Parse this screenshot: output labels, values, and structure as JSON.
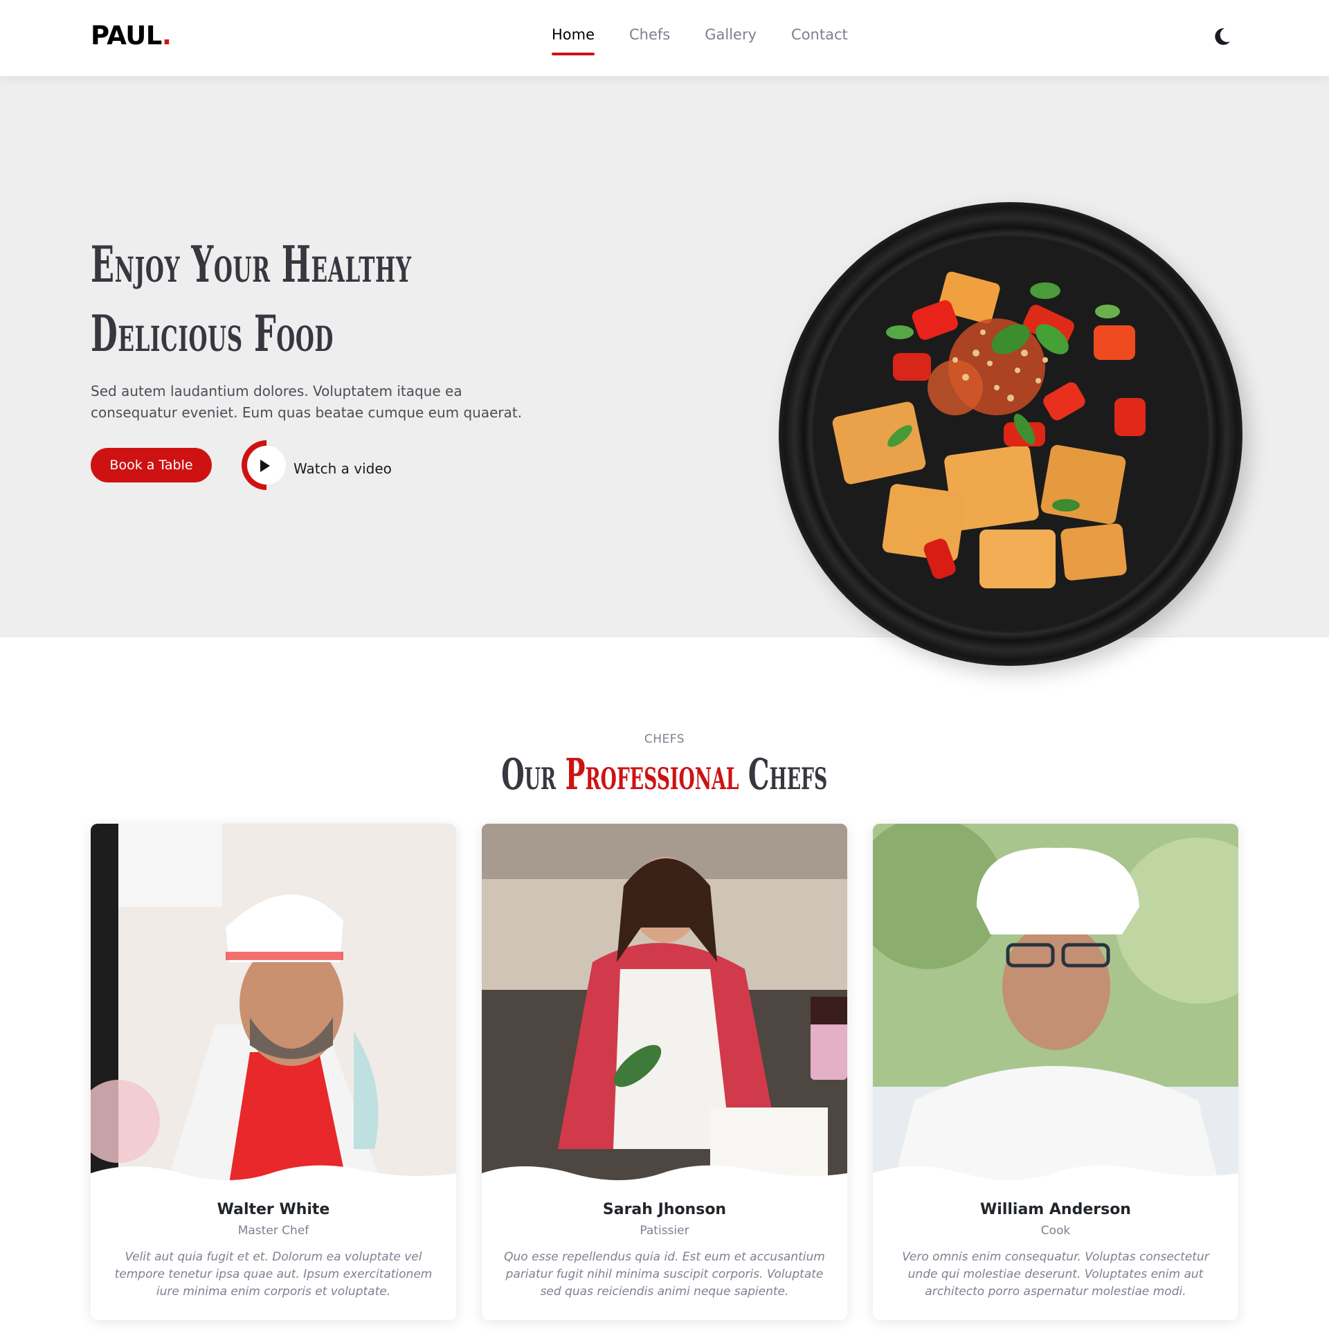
{
  "brand": {
    "name": "PAUL",
    "dot": "."
  },
  "nav": {
    "items": [
      {
        "label": "Home",
        "active": true
      },
      {
        "label": "Chefs",
        "active": false
      },
      {
        "label": "Gallery",
        "active": false
      },
      {
        "label": "Contact",
        "active": false
      }
    ],
    "theme_icon": "moon-icon"
  },
  "hero": {
    "title_line1": "Enjoy Your Healthy",
    "title_line2": "Delicious Food",
    "text": "Sed autem laudantium dolores. Voluptatem itaque ea consequatur eveniet. Eum quas beatae cumque eum quaerat.",
    "book_label": "Book a Table",
    "watch_label": "Watch a video"
  },
  "chefs": {
    "label": "CHEFS",
    "title_pre": "Our ",
    "title_accent": "Professional",
    "title_post": " Chefs",
    "cards": [
      {
        "name": "Walter White",
        "role": "Master Chef",
        "desc": "Velit aut quia fugit et et. Dolorum ea voluptate vel tempore tenetur ipsa quae aut. Ipsum exercitationem iure minima enim corporis et voluptate."
      },
      {
        "name": "Sarah Jhonson",
        "role": "Patissier",
        "desc": "Quo esse repellendus quia id. Est eum et accusantium pariatur fugit nihil minima suscipit corporis. Voluptate sed quas reiciendis animi neque sapiente."
      },
      {
        "name": "William Anderson",
        "role": "Cook",
        "desc": "Vero omnis enim consequatur. Voluptas consectetur unde qui molestiae deserunt. Voluptates enim aut architecto porro aspernatur molestiae modi."
      }
    ]
  },
  "colors": {
    "accent": "#ce1212",
    "text": "#37373f",
    "muted": "#7f7f90",
    "hero_bg": "#eeeeee"
  }
}
